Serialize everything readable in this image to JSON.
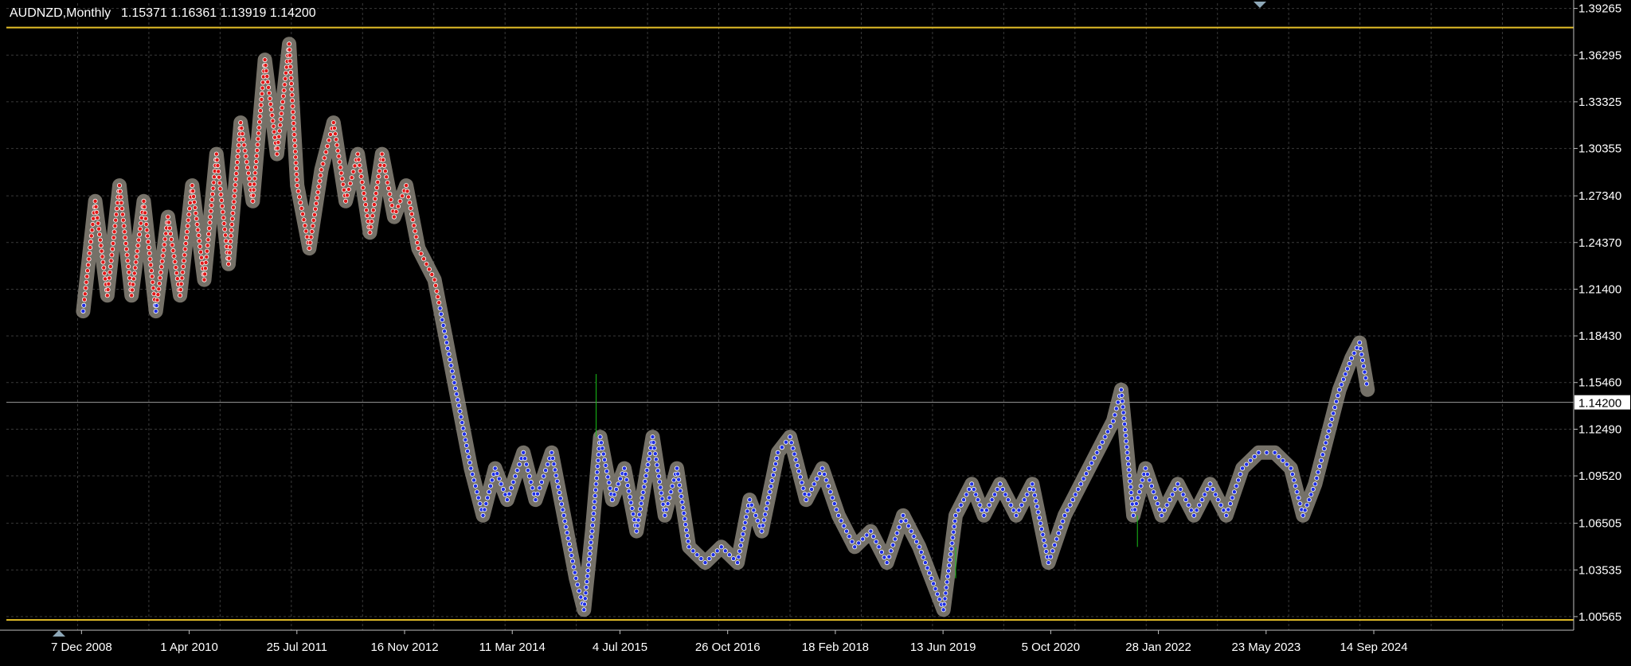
{
  "header": {
    "symbol_timeframe": "AUDNZD,Monthly",
    "ohlc": "1.15371 1.16361 1.13919 1.14200"
  },
  "colors": {
    "background": "#000000",
    "grid": "#3a3a3a",
    "axis": "#c0c0c0",
    "text": "#ffffff",
    "bull_dots": "#1e2ee6",
    "bear_dots": "#e01818",
    "dot_halo": "#8a857a",
    "level_lines": "#e6c028",
    "current_price_line": "#9a9a9a",
    "wick": "#19c019"
  },
  "chart_data": {
    "type": "line",
    "title": "AUDNZD,Monthly",
    "subtitle": "1.15371 1.16361 1.13919 1.14200",
    "y_ticks": [
      "1.39265",
      "1.36295",
      "1.33325",
      "1.30355",
      "1.27340",
      "1.24370",
      "1.21400",
      "1.18430",
      "1.15460",
      "1.12490",
      "1.09520",
      "1.06505",
      "1.03535",
      "1.00565"
    ],
    "x_ticks": [
      "7 Dec 2008",
      "1 Apr 2010",
      "25 Jul 2011",
      "16 Nov 2012",
      "11 Mar 2014",
      "4 Jul 2015",
      "26 Oct 2016",
      "18 Feb 2018",
      "13 Jun 2019",
      "5 Oct 2020",
      "28 Jan 2022",
      "23 May 2023",
      "14 Sep 2024"
    ],
    "ylim": [
      0.997,
      1.396
    ],
    "current_price": "1.14200",
    "current_price_value": 1.142,
    "level_lines": [
      1.3805,
      1.0035
    ],
    "grid": true,
    "series": [
      {
        "points": [
          [
            2008.95,
            1.2
          ],
          [
            2009.1,
            1.27
          ],
          [
            2009.25,
            1.21
          ],
          [
            2009.4,
            1.28
          ],
          [
            2009.55,
            1.21
          ],
          [
            2009.7,
            1.27
          ],
          [
            2009.85,
            1.2
          ],
          [
            2010.0,
            1.26
          ],
          [
            2010.15,
            1.21
          ],
          [
            2010.3,
            1.28
          ],
          [
            2010.45,
            1.22
          ],
          [
            2010.6,
            1.3
          ],
          [
            2010.75,
            1.23
          ],
          [
            2010.9,
            1.32
          ],
          [
            2011.05,
            1.27
          ],
          [
            2011.2,
            1.36
          ],
          [
            2011.35,
            1.3
          ],
          [
            2011.5,
            1.37
          ],
          [
            2011.6,
            1.28
          ],
          [
            2011.75,
            1.24
          ],
          [
            2011.9,
            1.29
          ],
          [
            2012.05,
            1.32
          ],
          [
            2012.2,
            1.27
          ],
          [
            2012.35,
            1.3
          ],
          [
            2012.5,
            1.25
          ],
          [
            2012.65,
            1.3
          ],
          [
            2012.8,
            1.26
          ],
          [
            2012.95,
            1.28
          ],
          [
            2013.1,
            1.24
          ],
          [
            2013.3,
            1.22
          ],
          [
            2013.45,
            1.18
          ],
          [
            2013.6,
            1.14
          ],
          [
            2013.75,
            1.1
          ],
          [
            2013.9,
            1.07
          ],
          [
            2014.05,
            1.1
          ],
          [
            2014.2,
            1.08
          ],
          [
            2014.4,
            1.11
          ],
          [
            2014.55,
            1.08
          ],
          [
            2014.75,
            1.11
          ],
          [
            2014.9,
            1.07
          ],
          [
            2015.05,
            1.03
          ],
          [
            2015.15,
            1.01
          ],
          [
            2015.25,
            1.06
          ],
          [
            2015.35,
            1.12
          ],
          [
            2015.5,
            1.08
          ],
          [
            2015.65,
            1.1
          ],
          [
            2015.8,
            1.06
          ],
          [
            2016.0,
            1.12
          ],
          [
            2016.15,
            1.07
          ],
          [
            2016.3,
            1.1
          ],
          [
            2016.45,
            1.05
          ],
          [
            2016.65,
            1.04
          ],
          [
            2016.85,
            1.05
          ],
          [
            2017.05,
            1.04
          ],
          [
            2017.2,
            1.08
          ],
          [
            2017.35,
            1.06
          ],
          [
            2017.55,
            1.11
          ],
          [
            2017.7,
            1.12
          ],
          [
            2017.9,
            1.08
          ],
          [
            2018.1,
            1.1
          ],
          [
            2018.3,
            1.07
          ],
          [
            2018.5,
            1.05
          ],
          [
            2018.7,
            1.06
          ],
          [
            2018.9,
            1.04
          ],
          [
            2019.1,
            1.07
          ],
          [
            2019.3,
            1.05
          ],
          [
            2019.45,
            1.03
          ],
          [
            2019.6,
            1.01
          ],
          [
            2019.75,
            1.07
          ],
          [
            2019.95,
            1.09
          ],
          [
            2020.1,
            1.07
          ],
          [
            2020.3,
            1.09
          ],
          [
            2020.5,
            1.07
          ],
          [
            2020.7,
            1.09
          ],
          [
            2020.9,
            1.04
          ],
          [
            2021.1,
            1.07
          ],
          [
            2021.3,
            1.09
          ],
          [
            2021.5,
            1.11
          ],
          [
            2021.7,
            1.13
          ],
          [
            2021.8,
            1.15
          ],
          [
            2021.95,
            1.07
          ],
          [
            2022.1,
            1.1
          ],
          [
            2022.3,
            1.07
          ],
          [
            2022.5,
            1.09
          ],
          [
            2022.7,
            1.07
          ],
          [
            2022.9,
            1.09
          ],
          [
            2023.1,
            1.07
          ],
          [
            2023.3,
            1.1
          ],
          [
            2023.5,
            1.11
          ],
          [
            2023.7,
            1.11
          ],
          [
            2023.9,
            1.1
          ],
          [
            2024.05,
            1.07
          ],
          [
            2024.2,
            1.09
          ],
          [
            2024.35,
            1.12
          ],
          [
            2024.5,
            1.15
          ],
          [
            2024.65,
            1.17
          ],
          [
            2024.75,
            1.18
          ],
          [
            2024.85,
            1.15
          ]
        ]
      }
    ]
  }
}
